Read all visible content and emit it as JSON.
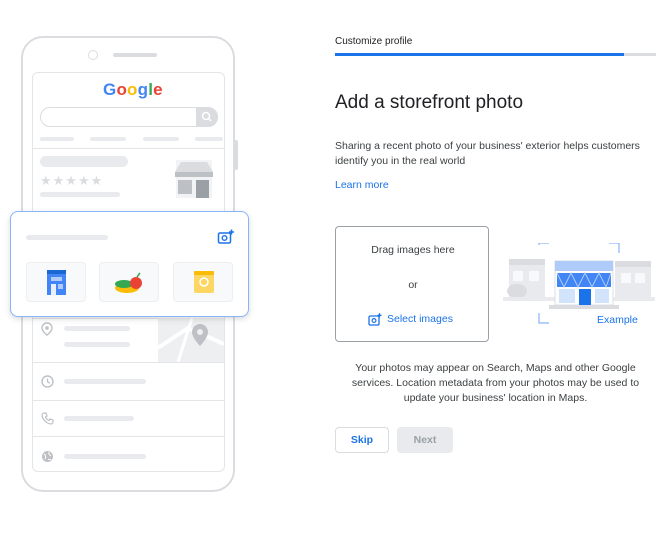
{
  "phone": {
    "brand": [
      "G",
      "o",
      "o",
      "g",
      "l",
      "e"
    ],
    "stars": "★★★★★"
  },
  "header": {
    "step_label": "Customize profile",
    "progress": 0.9
  },
  "main": {
    "title": "Add a storefront photo",
    "description": "Sharing a recent photo of your business' exterior helps customers identify you in the real world",
    "learn_more": "Learn more"
  },
  "upload": {
    "drag_text": "Drag images here",
    "or_text": "or",
    "select_label": "Select images"
  },
  "example": {
    "label": "Example"
  },
  "note": "Your photos may appear on Search, Maps and other Google services. Location metadata from your photos may be used to update your business' location in Maps.",
  "actions": {
    "skip_label": "Skip",
    "next_label": "Next",
    "next_disabled": true
  },
  "colors": {
    "accent": "#1a73e8",
    "border": "#dadce0",
    "card_border": "#8ab4f8"
  }
}
